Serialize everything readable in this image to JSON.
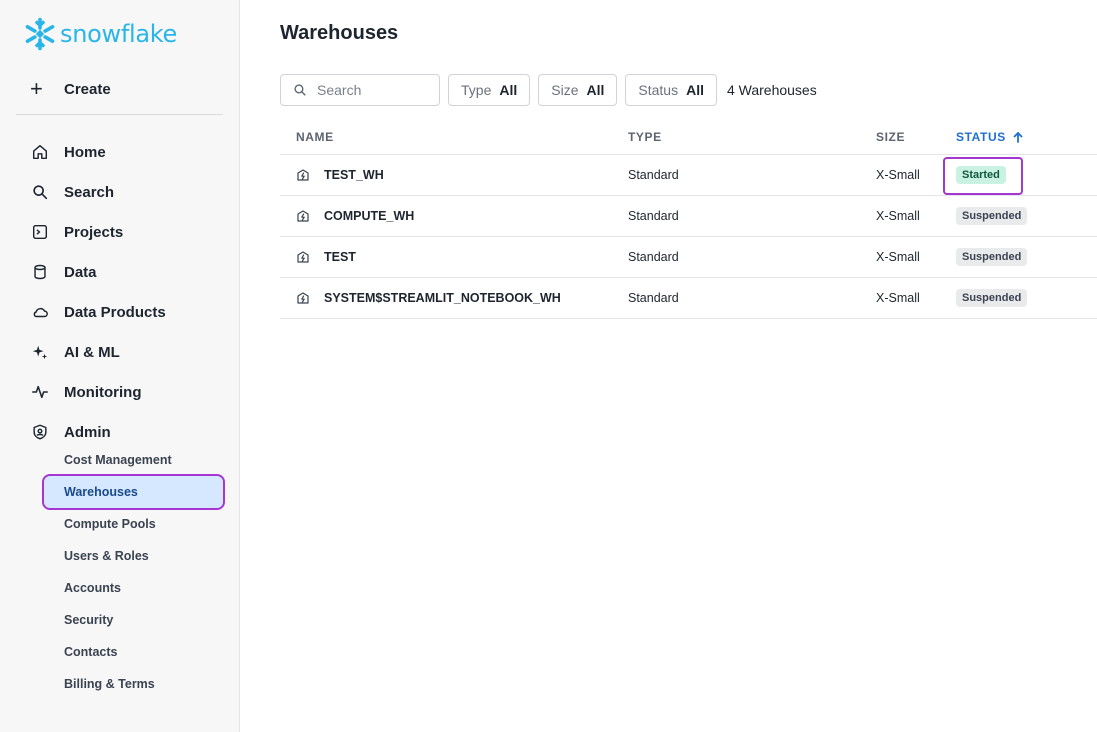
{
  "brand": {
    "name": "snowflake",
    "color": "#29b5e8"
  },
  "sidebar": {
    "create_label": "Create",
    "nav": [
      {
        "label": "Home",
        "icon": "home-icon"
      },
      {
        "label": "Search",
        "icon": "search-icon"
      },
      {
        "label": "Projects",
        "icon": "projects-icon"
      },
      {
        "label": "Data",
        "icon": "database-icon"
      },
      {
        "label": "Data Products",
        "icon": "cloud-icon"
      },
      {
        "label": "AI & ML",
        "icon": "sparkle-icon"
      },
      {
        "label": "Monitoring",
        "icon": "activity-icon"
      },
      {
        "label": "Admin",
        "icon": "shield-icon"
      }
    ],
    "admin_sub": [
      {
        "label": "Cost Management",
        "active": false
      },
      {
        "label": "Warehouses",
        "active": true
      },
      {
        "label": "Compute Pools",
        "active": false
      },
      {
        "label": "Users & Roles",
        "active": false
      },
      {
        "label": "Accounts",
        "active": false
      },
      {
        "label": "Security",
        "active": false
      },
      {
        "label": "Contacts",
        "active": false
      },
      {
        "label": "Billing & Terms",
        "active": false
      }
    ]
  },
  "main": {
    "title": "Warehouses",
    "search_placeholder": "Search",
    "filters": [
      {
        "key": "Type",
        "value": "All"
      },
      {
        "key": "Size",
        "value": "All"
      },
      {
        "key": "Status",
        "value": "All"
      }
    ],
    "count_label": "4 Warehouses",
    "columns": {
      "name": "NAME",
      "type": "TYPE",
      "size": "SIZE",
      "status": "STATUS"
    },
    "rows": [
      {
        "name": "TEST_WH",
        "type": "Standard",
        "size": "X-Small",
        "status": "Started"
      },
      {
        "name": "COMPUTE_WH",
        "type": "Standard",
        "size": "X-Small",
        "status": "Suspended"
      },
      {
        "name": "TEST",
        "type": "Standard",
        "size": "X-Small",
        "status": "Suspended"
      },
      {
        "name": "SYSTEM$STREAMLIT_NOTEBOOK_WH",
        "type": "Standard",
        "size": "X-Small",
        "status": "Suspended"
      }
    ]
  },
  "colors": {
    "accent": "#1f6fd1",
    "highlight": "#a537d1",
    "started_bg": "#c9f2e3",
    "suspended_bg": "#e9eaec"
  }
}
